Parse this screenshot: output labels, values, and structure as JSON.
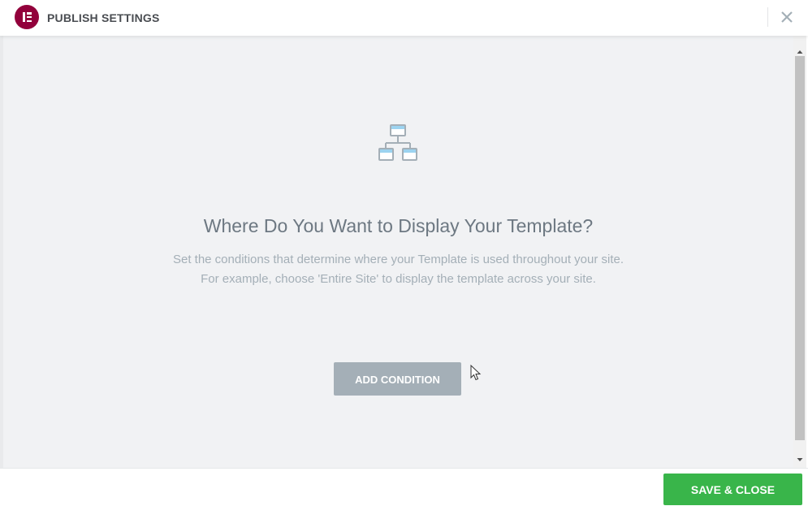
{
  "header": {
    "title": "PUBLISH SETTINGS",
    "logo_icon": "elementor-logo-icon",
    "close_icon": "close-icon"
  },
  "main": {
    "icon": "sitemap-icon",
    "title": "Where Do You Want to Display Your Template?",
    "description_line1": "Set the conditions that determine where your Template is used throughout your site.",
    "description_line2": "For example, choose 'Entire Site' to display the template across your site.",
    "add_condition_label": "ADD CONDITION"
  },
  "footer": {
    "save_label": "SAVE & CLOSE"
  },
  "colors": {
    "brand": "#92003b",
    "save_button": "#39b54a",
    "add_button": "#a4afb7",
    "body_background": "#f1f2f4",
    "title_text": "#6d7882",
    "description_text": "#a4afb7"
  }
}
